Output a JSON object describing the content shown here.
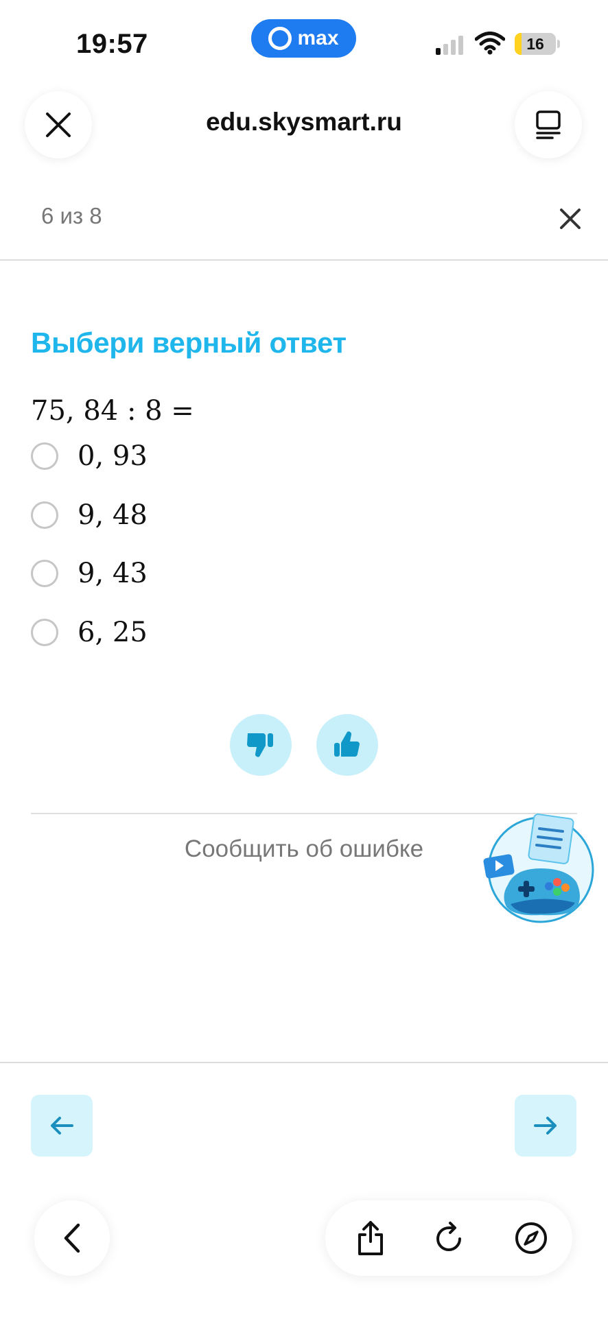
{
  "status_bar": {
    "time": "19:57",
    "app_pill_label": "max",
    "battery_percent": "16",
    "battery_level": 0.16,
    "signal_bars_active": 1,
    "signal_bars_total": 4
  },
  "browser": {
    "url": "edu.skysmart.ru",
    "close_icon": "close-icon",
    "tabs_icon": "tabs-icon"
  },
  "page": {
    "progress": "6 из 8",
    "close_icon": "close-icon"
  },
  "task": {
    "title": "Выбери верный ответ",
    "expression": "75, 84 : 8 =",
    "options": [
      {
        "label": "0, 93",
        "selected": false
      },
      {
        "label": "9, 48",
        "selected": false
      },
      {
        "label": "9, 43",
        "selected": false
      },
      {
        "label": "6, 25",
        "selected": false
      }
    ]
  },
  "feedback": {
    "dislike_icon": "thumbs-down-icon",
    "like_icon": "thumbs-up-icon",
    "report_label": "Сообщить об ошибке"
  },
  "navigation": {
    "prev_icon": "arrow-left-icon",
    "next_icon": "arrow-right-icon"
  },
  "toolbar": {
    "back_icon": "chevron-left-icon",
    "share_icon": "share-icon",
    "reload_icon": "reload-icon",
    "compass_icon": "compass-icon"
  },
  "colors": {
    "accent": "#1fb6ec",
    "accent_light": "#c8f0fa",
    "nav_button_bg": "#d6f4fb",
    "nav_arrow": "#1a8fbd",
    "pill_blue": "#1f7cf0",
    "battery_yellow": "#ffd21f"
  }
}
